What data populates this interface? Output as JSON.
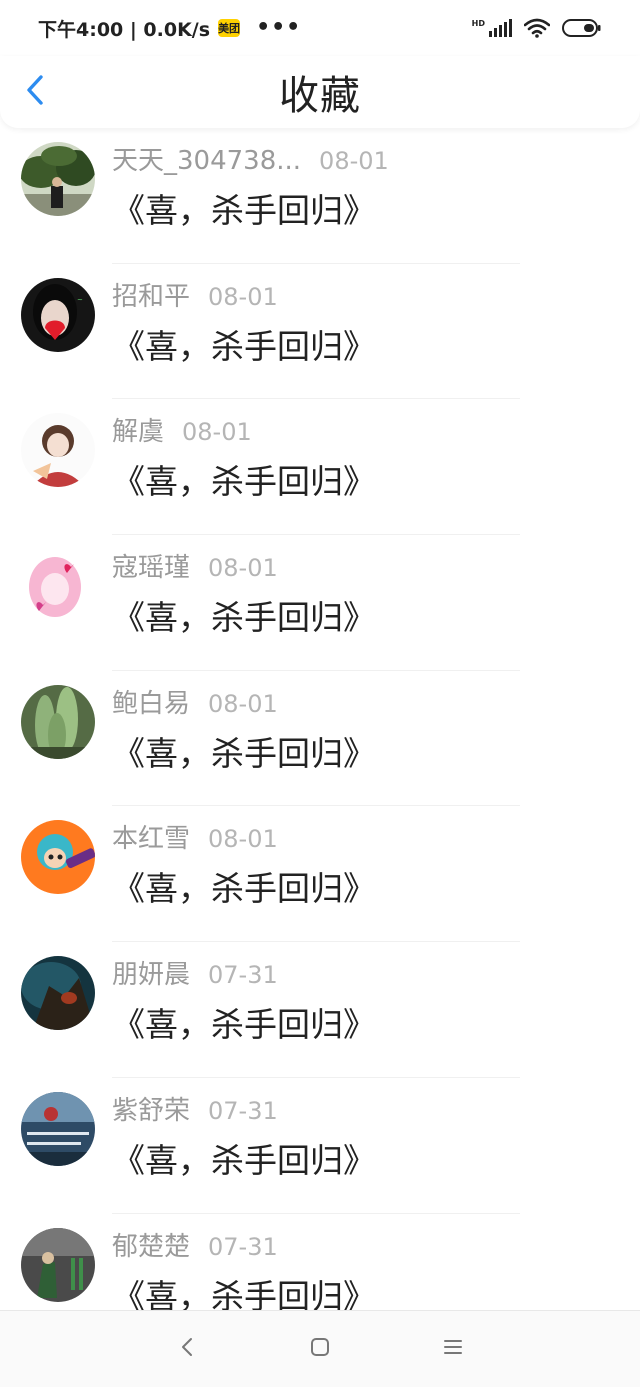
{
  "status_bar": {
    "carrier_time": "下午4:00 | 0.0K/s",
    "app_badge": "美团",
    "more": "•••",
    "network_type": "HD"
  },
  "header": {
    "title": "收藏",
    "back_icon": "chevron-left-icon",
    "accent_color": "#2d8cf0"
  },
  "favorites": [
    {
      "name": "天天_304738...",
      "date": "08-01",
      "content": "《喜，杀手回归》"
    },
    {
      "name": "招和平",
      "date": "08-01",
      "content": "《喜，杀手回归》"
    },
    {
      "name": "解虞",
      "date": "08-01",
      "content": "《喜，杀手回归》"
    },
    {
      "name": "寇瑶瑾",
      "date": "08-01",
      "content": "《喜，杀手回归》"
    },
    {
      "name": "鲍白易",
      "date": "08-01",
      "content": "《喜，杀手回归》"
    },
    {
      "name": "本红雪",
      "date": "08-01",
      "content": "《喜，杀手回归》"
    },
    {
      "name": "朋妍晨",
      "date": "07-31",
      "content": "《喜，杀手回归》"
    },
    {
      "name": "紫舒荣",
      "date": "07-31",
      "content": "《喜，杀手回归》"
    },
    {
      "name": "郁楚楚",
      "date": "07-31",
      "content": "《喜，杀手回归》"
    }
  ],
  "nav_bar": {
    "back": "nav-back-icon",
    "home": "nav-home-icon",
    "menu": "nav-menu-icon"
  }
}
